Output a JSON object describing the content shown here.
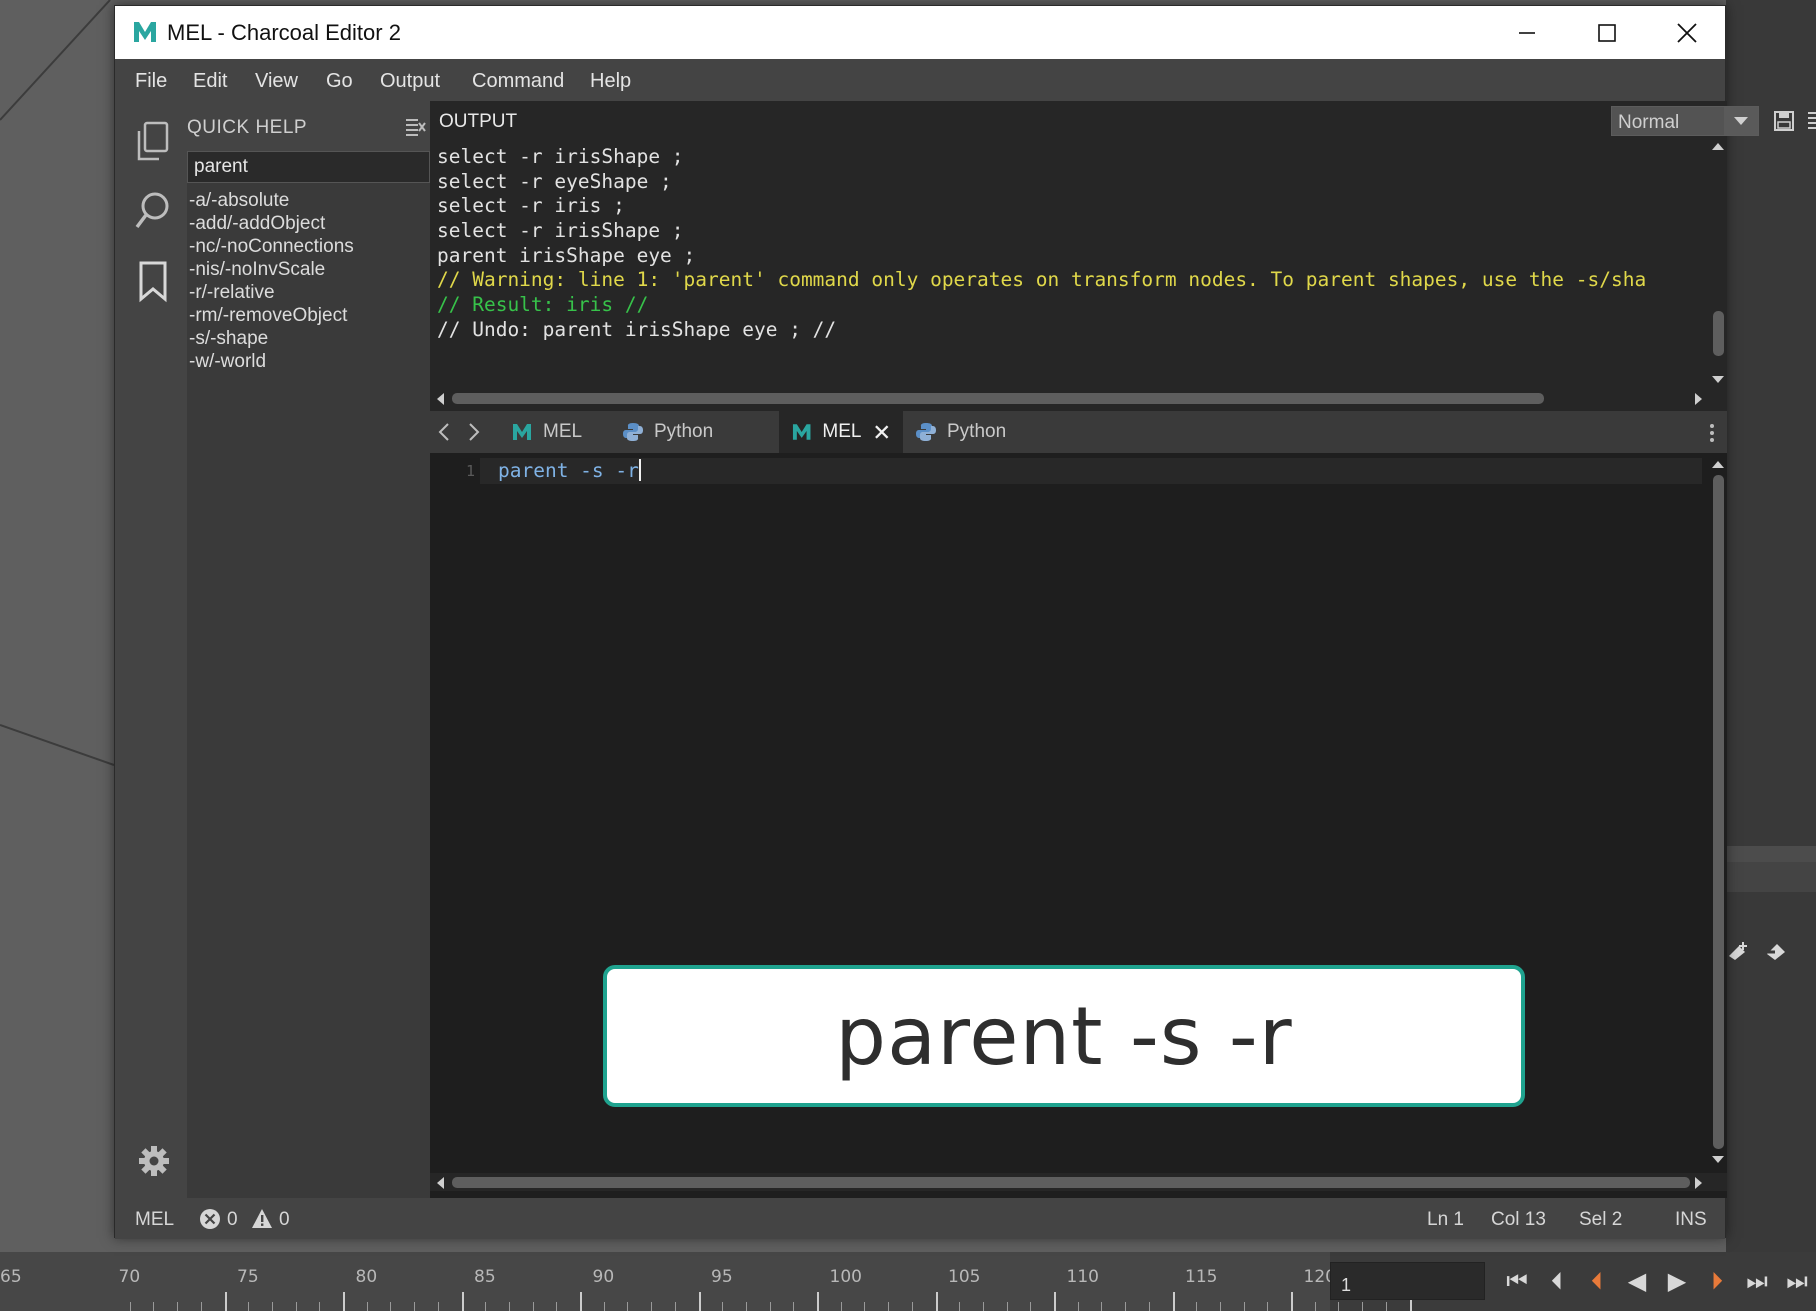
{
  "window": {
    "title": "MEL - Charcoal Editor 2",
    "app_icon": "maya-m-icon",
    "controls": [
      "minimize-icon",
      "maximize-icon",
      "close-icon"
    ]
  },
  "menu": {
    "items": [
      "File",
      "Edit",
      "View",
      "Go",
      "Output",
      "Command",
      "Help"
    ]
  },
  "side_icons": [
    "copy-icon",
    "search-icon",
    "bookmark-icon"
  ],
  "quick_help": {
    "title": "QUICK HELP",
    "search_value": "parent",
    "flags": [
      "-a/-absolute",
      "-add/-addObject",
      "-nc/-noConnections",
      "-nis/-noInvScale",
      "-r/-relative",
      "-rm/-removeObject",
      "-s/-shape",
      "-w/-world"
    ]
  },
  "output": {
    "title": "OUTPUT",
    "mode": "Normal",
    "lines": [
      {
        "text": "select -r irisShape ;",
        "kind": "normal"
      },
      {
        "text": "select -r eyeShape ;",
        "kind": "normal"
      },
      {
        "text": "select -r iris ;",
        "kind": "normal"
      },
      {
        "text": "select -r irisShape ;",
        "kind": "normal"
      },
      {
        "text": "parent irisShape eye ;",
        "kind": "normal"
      },
      {
        "text": "// Warning: line 1: 'parent' command only operates on transform nodes. To parent shapes, use the -s/sha",
        "kind": "warning"
      },
      {
        "text": "// Result: iris //",
        "kind": "result"
      },
      {
        "text": "// Undo: parent irisShape eye ; //",
        "kind": "normal"
      }
    ]
  },
  "tabs": [
    {
      "label": "MEL",
      "icon": "mel-icon",
      "active": false
    },
    {
      "label": "Python",
      "icon": "python-icon",
      "active": false
    },
    {
      "label": "MEL",
      "icon": "mel-icon",
      "active": true
    },
    {
      "label": "Python",
      "icon": "python-icon",
      "active": false
    }
  ],
  "editor": {
    "line_number": "1",
    "code": "parent -s -r"
  },
  "caption": {
    "text": "parent -s -r"
  },
  "status": {
    "language": "MEL",
    "errors": "0",
    "warnings": "0",
    "line": "Ln 1",
    "column": "Col 13",
    "selection": "Sel 2",
    "mode": "INS"
  },
  "timeline": {
    "ticks": [
      "65",
      "70",
      "75",
      "80",
      "85",
      "90",
      "95",
      "100",
      "105",
      "110",
      "115",
      "120"
    ],
    "current_frame": "1"
  },
  "colors": {
    "accent": "#1fa38f",
    "warning": "#e0d84a",
    "result": "#37c24a",
    "code": "#7fb2e5"
  }
}
